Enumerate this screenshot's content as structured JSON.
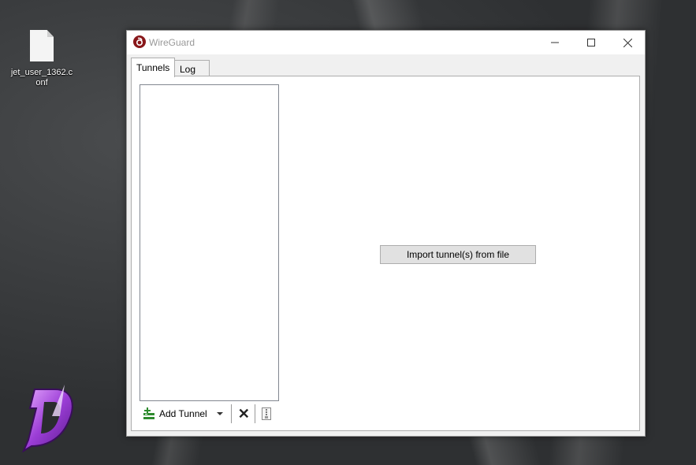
{
  "desktop": {
    "file_icon_label": "jet_user_1362.conf",
    "logo_icon": "d-logo-icon"
  },
  "window": {
    "title": "WireGuard",
    "controls": {
      "minimize": "minimize-icon",
      "maximize": "maximize-icon",
      "close": "close-icon"
    }
  },
  "tabs": [
    {
      "label": "Tunnels",
      "active": true
    },
    {
      "label": "Log",
      "active": false
    }
  ],
  "tunnels": {
    "items": [],
    "toolbar": {
      "add_label": "Add Tunnel",
      "add_icon": "add-tunnel-icon",
      "dropdown_icon": "chevron-down-icon",
      "delete_icon": "delete-icon",
      "export_icon": "export-zip-icon"
    }
  },
  "main": {
    "import_button_label": "Import tunnel(s) from file"
  },
  "colors": {
    "brand": "#88171a",
    "accent_green": "#2e8b2e"
  }
}
